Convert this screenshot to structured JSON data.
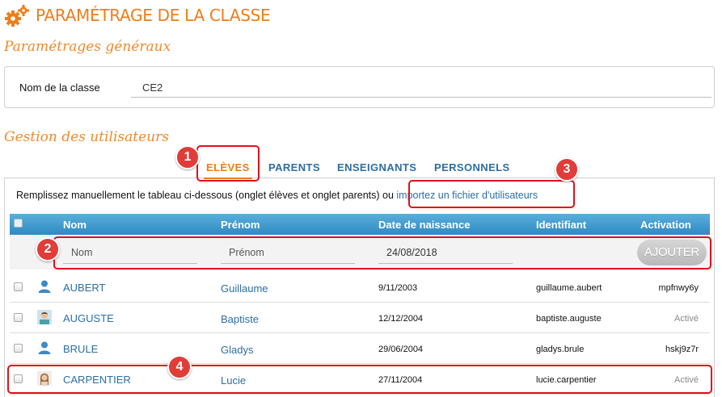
{
  "header": {
    "title": "PARAMÉTRAGE DE LA CLASSE",
    "icon": "gears-icon"
  },
  "general": {
    "section_title": "Paramétrages généraux",
    "class_name_label": "Nom de la classe",
    "class_name_value": "CE2"
  },
  "users": {
    "section_title": "Gestion des utilisateurs",
    "tabs": [
      "ELÈVES",
      "PARENTS",
      "ENSEIGNANTS",
      "PERSONNELS"
    ],
    "active_tab": 0,
    "info_text": "Remplissez manuellement le tableau ci-dessous (onglet élèves et onglet parents) ou ",
    "import_link": "importez un fichier d'utilisateurs",
    "columns": [
      "Nom",
      "Prénom",
      "Date de naissance",
      "Identifiant",
      "Activation"
    ],
    "new_row": {
      "nom_placeholder": "Nom",
      "prenom_placeholder": "Prénom",
      "date_value": "24/08/2018",
      "add_label": "AJOUTER"
    },
    "rows": [
      {
        "nom": "AUBERT",
        "prenom": "Guillaume",
        "date": "9/11/2003",
        "identifiant": "guillaume.aubert",
        "activation": "mpfnwy6y",
        "avatar": "person-icon",
        "activated": false
      },
      {
        "nom": "AUGUSTE",
        "prenom": "Baptiste",
        "date": "12/12/2004",
        "identifiant": "baptiste.auguste",
        "activation": "Activé",
        "avatar": "photo-avatar",
        "activated": true
      },
      {
        "nom": "BRULE",
        "prenom": "Gladys",
        "date": "29/06/2004",
        "identifiant": "gladys.brule",
        "activation": "hskj9z7r",
        "avatar": "person-icon",
        "activated": false
      },
      {
        "nom": "CARPENTIER",
        "prenom": "Lucie",
        "date": "27/11/2004",
        "identifiant": "lucie.carpentier",
        "activation": "Activé",
        "avatar": "photo-avatar",
        "activated": true
      }
    ]
  },
  "annotations": [
    "1",
    "2",
    "3",
    "4"
  ],
  "colors": {
    "accent": "#f07d1a",
    "link": "#2d6ea3",
    "header_blue": "#3f97cc",
    "callout_red": "#e0101a"
  }
}
